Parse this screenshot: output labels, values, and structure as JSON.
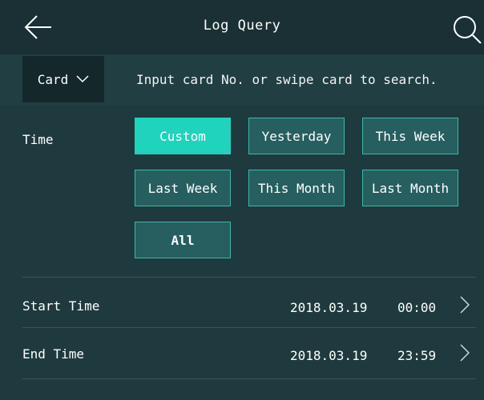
{
  "header": {
    "title": "Log Query",
    "back_icon": "arrow-left-icon",
    "search_icon": "search-icon"
  },
  "search": {
    "type_selected": "Card",
    "hint": "Input card No. or swipe card to search."
  },
  "time_filter": {
    "label": "Time",
    "options": [
      "Custom",
      "Yesterday",
      "This Week",
      "Last Week",
      "This Month",
      "Last Month",
      "All"
    ],
    "selected": "Custom"
  },
  "start_time": {
    "label": "Start Time",
    "date": "2018.03.19",
    "time": "00:00"
  },
  "end_time": {
    "label": "End Time",
    "date": "2018.03.19",
    "time": "23:59"
  },
  "colors": {
    "background": "#1f3a3e",
    "header": "#1a3034",
    "active_button": "#1fd3bd",
    "button": "#275e60",
    "button_border": "#3ab8a8"
  }
}
